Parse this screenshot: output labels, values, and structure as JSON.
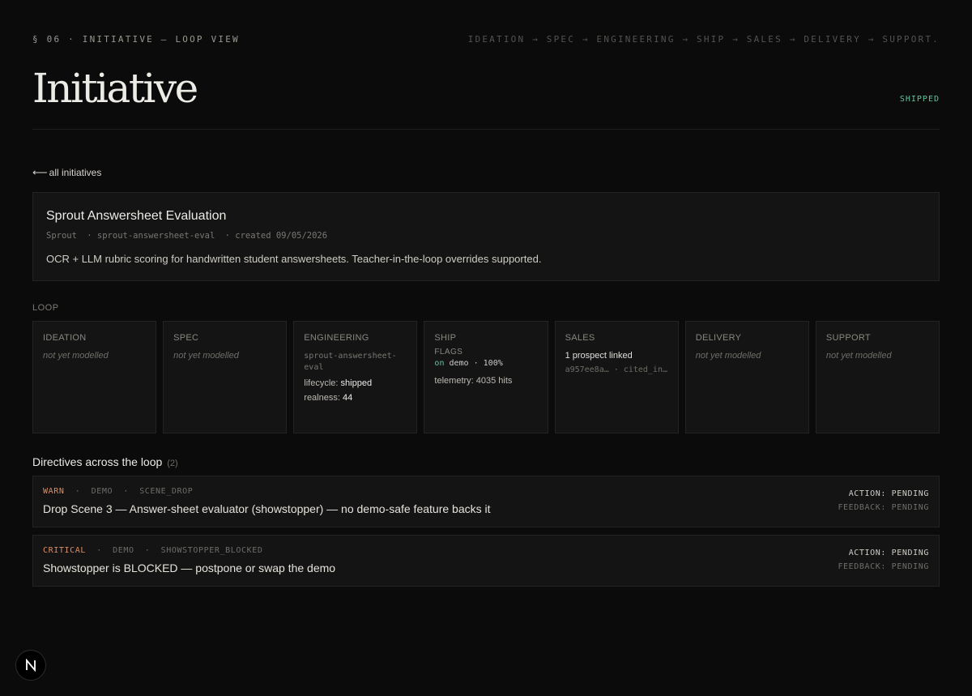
{
  "header": {
    "section": "§ 06 · INITIATIVE — LOOP VIEW",
    "flow": "IDEATION → SPEC → ENGINEERING → SHIP → SALES → DELIVERY → SUPPORT.",
    "title": "Initiative",
    "status": "SHIPPED"
  },
  "back_link": "all initiatives",
  "initiative": {
    "name": "Sprout Answersheet Evaluation",
    "org": "Sprout",
    "slug": "· sprout-answersheet-eval",
    "created": "· created 09/05/2026",
    "description": "OCR + LLM rubric scoring for handwritten student answersheets. Teacher-in-the-loop overrides supported."
  },
  "loop": {
    "label": "LOOP",
    "empty_text": "not yet modelled",
    "ideation": {
      "name": "IDEATION"
    },
    "spec": {
      "name": "SPEC"
    },
    "engineering": {
      "name": "ENGINEERING",
      "slug": "sprout-answersheet-eval",
      "lifecycle_label": "lifecycle: ",
      "lifecycle_value": "shipped",
      "realness_label": "realness: ",
      "realness_value": "44"
    },
    "ship": {
      "name": "SHIP",
      "flags_label": "FLAGS",
      "flag_state": "on",
      "flag_env": "demo",
      "flag_pct": "100%",
      "telemetry": "telemetry: 4035 hits"
    },
    "sales": {
      "name": "SALES",
      "prospect": "1 prospect linked",
      "prospect_id": "a957ee8a…",
      "prospect_ref": "cited_in…"
    },
    "delivery": {
      "name": "DELIVERY"
    },
    "support": {
      "name": "SUPPORT"
    }
  },
  "directives": {
    "heading": "Directives across the loop",
    "count": "(2)",
    "items": [
      {
        "severity": "WARN",
        "env": "DEMO",
        "code": "SCENE_DROP",
        "text": "Drop Scene 3 — Answer-sheet evaluator (showstopper) — no demo-safe feature backs it",
        "action": "ACTION: PENDING",
        "feedback": "FEEDBACK: PENDING"
      },
      {
        "severity": "CRITICAL",
        "env": "DEMO",
        "code": "SHOWSTOPPER_BLOCKED",
        "text": "Showstopper is BLOCKED — postpone or swap the demo",
        "action": "ACTION: PENDING",
        "feedback": "FEEDBACK: PENDING"
      }
    ]
  },
  "colors": {
    "background": "#0b0b0b",
    "panel": "#141414",
    "shipped": "#5fc39a",
    "warn": "#d98e66"
  },
  "icons": {
    "badge": "next-logo-icon",
    "back": "arrow-left-icon"
  }
}
